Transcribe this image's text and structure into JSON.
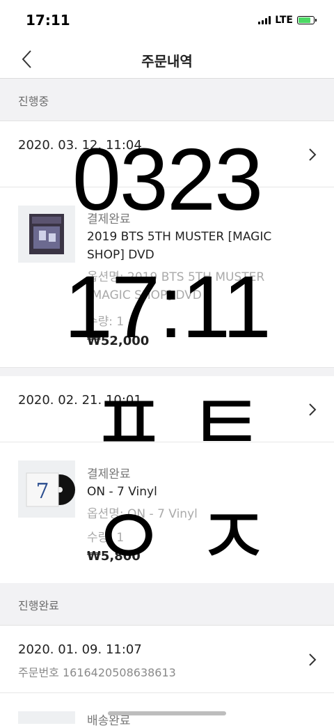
{
  "status_bar": {
    "time": "17:11",
    "network": "LTE"
  },
  "nav": {
    "title": "주문내역"
  },
  "sections": {
    "in_progress": "진행중",
    "completed": "진행완료"
  },
  "orders": [
    {
      "date": "2020. 03. 12. 11:04",
      "status": "결제완료",
      "product_name": "2019 BTS 5TH MUSTER [MAGIC SHOP] DVD",
      "option": "옵션명: 2019 BTS 5TH MUSTER [MAGIC SHOP] DVD",
      "quantity": "수량: 1",
      "price": "₩52,000"
    },
    {
      "date": "2020. 02. 21. 10:01",
      "status": "결제완료",
      "product_name": "ON - 7 Vinyl",
      "option": "옵션명: ON - 7 Vinyl",
      "quantity": "수량: 1",
      "price": "₩5,800"
    },
    {
      "date": "2020. 01. 09. 11:07",
      "order_number": "주문번호 1616420508638613",
      "status": "배송완료"
    }
  ],
  "overlay_text": {
    "line1": "0323",
    "line2": "17:11",
    "line3": "ㅍㅌ",
    "line4": "ㅇㅈ"
  },
  "icons": {
    "back": "chevron-left-icon",
    "row_arrow": "chevron-right-icon",
    "signal": "signal-icon",
    "battery": "battery-charging-icon"
  },
  "colors": {
    "battery_fill": "#4cd964",
    "section_bg": "#f2f2f4"
  }
}
